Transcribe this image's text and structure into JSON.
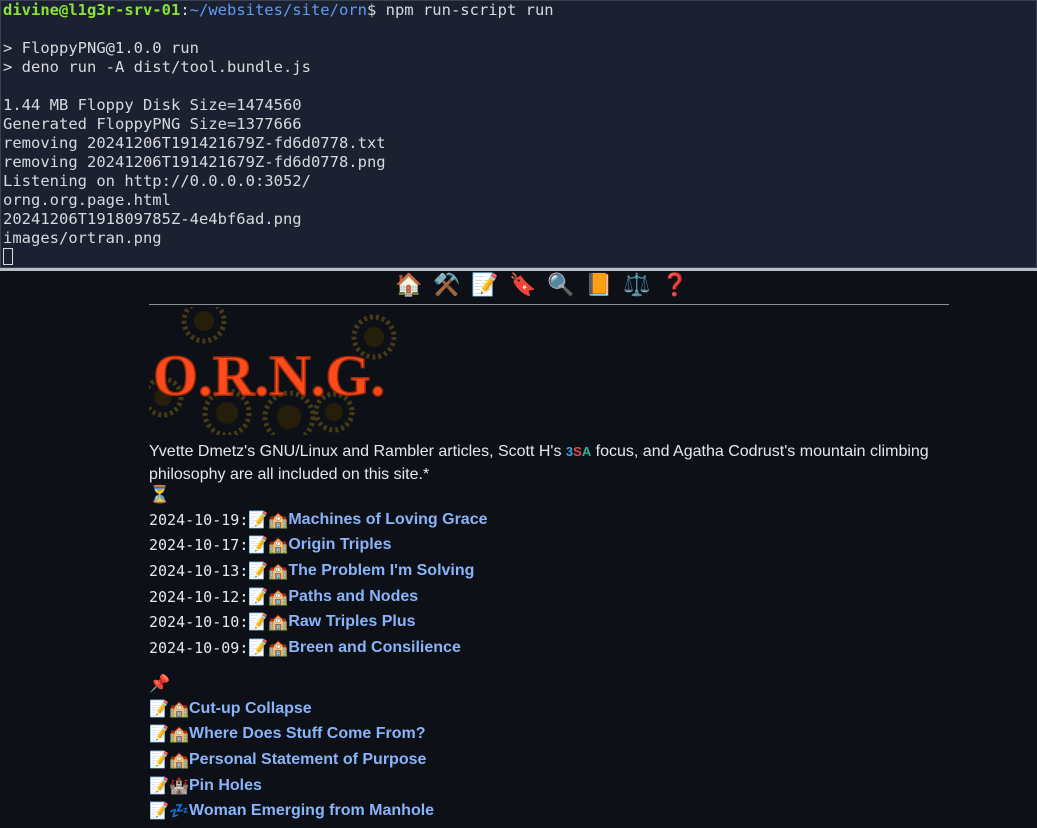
{
  "terminal": {
    "prompt_user": "divine@l1g3r-srv-01",
    "prompt_sep": ":",
    "prompt_path": "~/websites/site/orn",
    "prompt_symbol": "$",
    "command": " npm run-script run",
    "lines": [
      "",
      "> FloppyPNG@1.0.0 run",
      "> deno run -A dist/tool.bundle.js",
      "",
      "1.44 MB Floppy Disk Size=1474560",
      "Generated FloppyPNG Size=1377666",
      "removing 20241206T191421679Z-fd6d0778.txt",
      "removing 20241206T191421679Z-fd6d0778.png",
      "Listening on http://0.0.0.0:3052/",
      "orng.org.page.html",
      "20241206T191809785Z-4e4bf6ad.png",
      "images/ortran.png"
    ]
  },
  "nav": [
    {
      "icon": "home-icon",
      "glyph": "🏠"
    },
    {
      "icon": "tools-icon",
      "glyph": "⚒️"
    },
    {
      "icon": "memo-icon",
      "glyph": "📝"
    },
    {
      "icon": "bookmark-icon",
      "glyph": "🔖"
    },
    {
      "icon": "search-icon",
      "glyph": "🔍"
    },
    {
      "icon": "book-icon",
      "glyph": "📙"
    },
    {
      "icon": "scales-icon",
      "glyph": "⚖️"
    },
    {
      "icon": "question-icon",
      "glyph": "❓"
    }
  ],
  "logo_text": "O.R.N.G.",
  "intro": {
    "before": "Yvette Dmetz's GNU/Linux and Rambler articles, Scott H's ",
    "tsa": [
      "3",
      "S",
      "A"
    ],
    "after": " focus, and Agatha Codrust's mountain climbing philosophy are all included on this site.*"
  },
  "hourglass": "⏳",
  "recent": [
    {
      "date": "2024-10-19",
      "sep": ":",
      "e1": "📝",
      "e2": "🏫",
      "title": "Machines of Loving Grace"
    },
    {
      "date": "2024-10-17",
      "sep": ":",
      "e1": "📝",
      "e2": "🏫",
      "title": "Origin Triples"
    },
    {
      "date": "2024-10-13",
      "sep": ":",
      "e1": "📝",
      "e2": "🏫",
      "title": "The Problem I'm Solving"
    },
    {
      "date": "2024-10-12",
      "sep": ":",
      "e1": "📝",
      "e2": "🏫",
      "title": "Paths and Nodes"
    },
    {
      "date": "2024-10-10",
      "sep": ":",
      "e1": "📝",
      "e2": "🏫",
      "title": "Raw Triples Plus"
    },
    {
      "date": "2024-10-09",
      "sep": ":",
      "e1": "📝",
      "e2": "🏫",
      "title": "Breen and Consilience"
    }
  ],
  "pin": "📌",
  "pinned": [
    {
      "e1": "📝",
      "e2": "🏫",
      "title": "Cut-up Collapse"
    },
    {
      "e1": "📝",
      "e2": "🏫",
      "title": "Where Does Stuff Come From?"
    },
    {
      "e1": "📝",
      "e2": "🏫",
      "title": "Personal Statement of Purpose"
    },
    {
      "e1": "📝",
      "e2": "🏰",
      "title": "Pin Holes"
    },
    {
      "e1": "📝",
      "e2": "💤",
      "title": "Woman Emerging from Manhole"
    }
  ],
  "colors": {
    "link": "#8ab4f8",
    "logo": "#ff4a1c",
    "tsa_3": "#3aa3d8",
    "tsa_s": "#e5484d",
    "tsa_a": "#22b39a",
    "prompt_user": "#8ae234",
    "prompt_path": "#5c9cf5"
  }
}
